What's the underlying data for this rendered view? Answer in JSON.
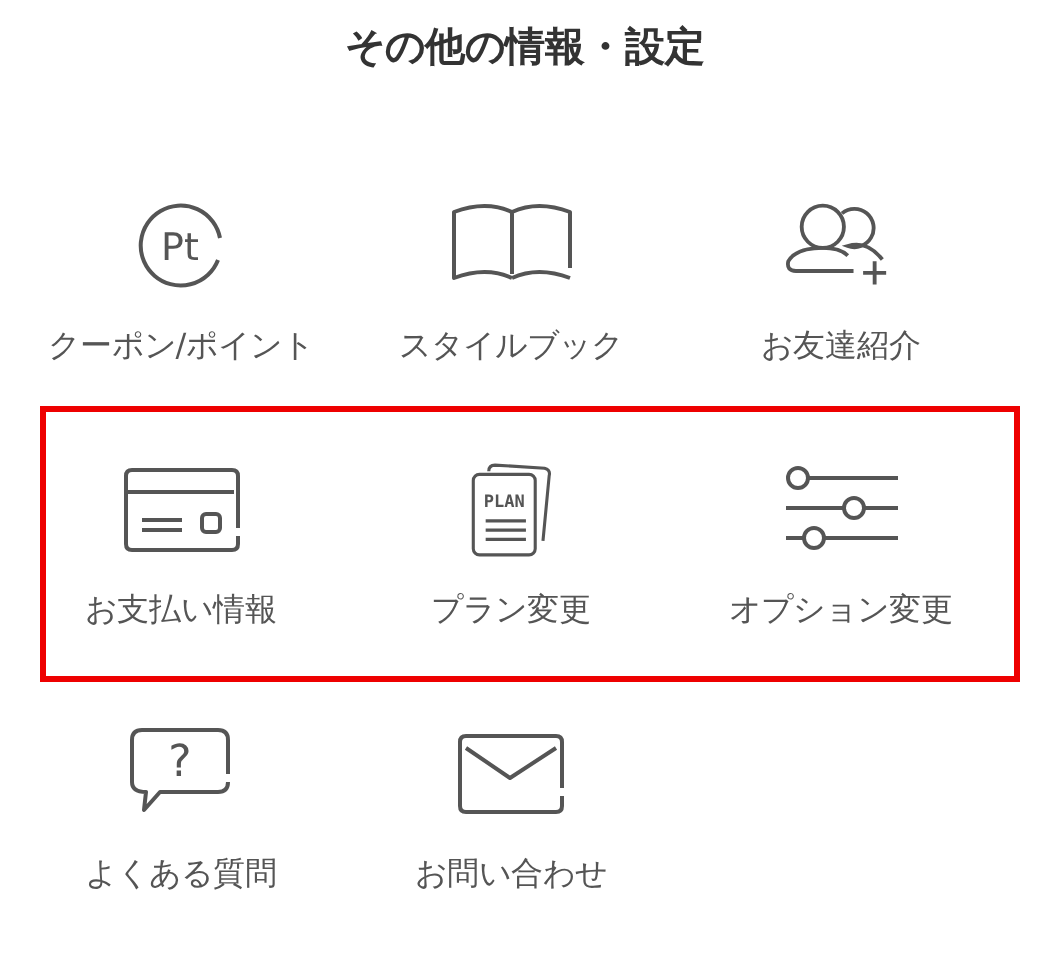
{
  "title": "その他の情報・設定",
  "rows": [
    {
      "highlighted": false,
      "items": [
        {
          "kind": "points",
          "icon_text": "Pt",
          "label": "クーポン/ポイント"
        },
        {
          "kind": "book",
          "label": "スタイルブック"
        },
        {
          "kind": "people",
          "label": "お友達紹介"
        }
      ]
    },
    {
      "highlighted": true,
      "items": [
        {
          "kind": "card",
          "label": "お支払い情報"
        },
        {
          "kind": "plan",
          "icon_text": "PLAN",
          "label": "プラン変更"
        },
        {
          "kind": "sliders",
          "label": "オプション変更"
        }
      ]
    },
    {
      "highlighted": false,
      "items": [
        {
          "kind": "question",
          "icon_text": "?",
          "label": "よくある質問"
        },
        {
          "kind": "mail",
          "label": "お問い合わせ"
        }
      ]
    }
  ]
}
